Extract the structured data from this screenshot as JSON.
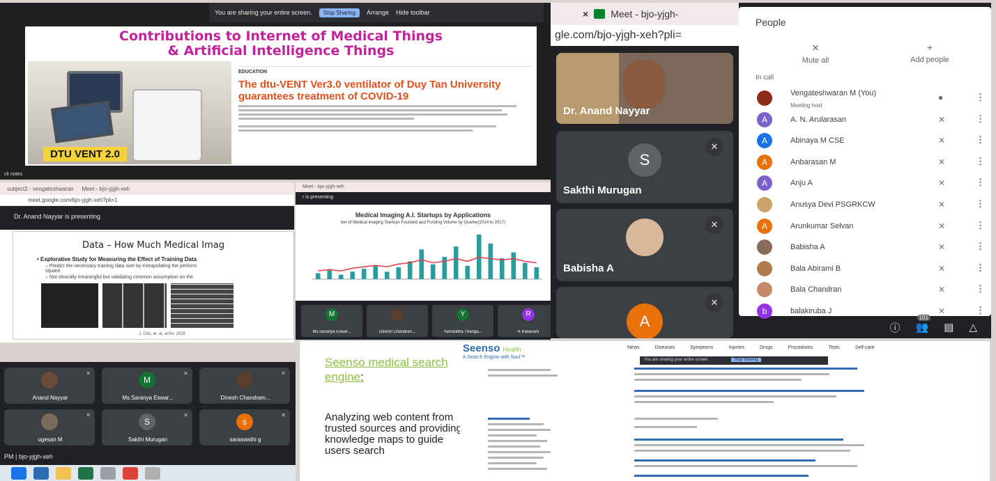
{
  "p1": {
    "sharebar": {
      "text": "You are sharing your entire screen.",
      "stop": "Stop Sharing",
      "arrange": "Arrange",
      "hide": "Hide toolbar"
    },
    "title_l1": "Contributions to Internet of Medical Things",
    "title_l2": "& Artificial Intelligence Things",
    "vent_label": "DTU VENT 2.0",
    "article_category": "EDUCATION",
    "headline": "The dtu-VENT Ver3.0 ventilator of Duy Tan University guarantees treatment of COVID-19",
    "footer": "ck notes"
  },
  "p2": {
    "tab_close": "×",
    "tab_title": "Meet - bjo-yjgh-",
    "url": "gle.com/bjo-yjgh-xeh?pli=",
    "tiles": [
      {
        "name": "Dr. Anand Nayyar"
      },
      {
        "name": "Sakthi Murugan",
        "initial": "S"
      },
      {
        "name": "Babisha A"
      },
      {
        "initial": "A"
      }
    ]
  },
  "p3": {
    "title": "People",
    "mute_all": "Mute all",
    "add_people": "Add people",
    "in_call": "In call",
    "badge": "101",
    "people": [
      {
        "name": "Vengateshwaran M (You)",
        "sub": "Meeting host",
        "color": "#8d2a1a",
        "initial": ""
      },
      {
        "name": "A. N. Arularasan",
        "color": "#7b61c9",
        "initial": "A"
      },
      {
        "name": "Abinaya M CSE",
        "color": "#1a73e8",
        "initial": "A"
      },
      {
        "name": "Anbarasan M",
        "color": "#e8710a",
        "initial": "A"
      },
      {
        "name": "Anju A",
        "color": "#7b61c9",
        "initial": "A"
      },
      {
        "name": "Anusya Devi PSGRKCW",
        "color": "#c9a36a",
        "initial": ""
      },
      {
        "name": "Arunkumar Selvan",
        "color": "#e8710a",
        "initial": "A"
      },
      {
        "name": "Babisha A",
        "color": "#8a6b5a",
        "initial": ""
      },
      {
        "name": "Bala Abirami B",
        "color": "#b07a4d",
        "initial": ""
      },
      {
        "name": "Bala Chandran",
        "color": "#c58a6a",
        "initial": ""
      },
      {
        "name": "balakiruba J",
        "color": "#9334e6",
        "initial": "b"
      }
    ]
  },
  "p4": {
    "tab1": "subject2 - vengateshwaran",
    "tab2": "Meet - bjo-yjgh-xeh",
    "url": "meet.google.com/bjo-yjgh-xeh?pli=1",
    "presenting": "Dr. Anand Nayyar is presenting",
    "slide_title": "Data – How Much Medical Imag",
    "bullet": "• Explorative Study for Measuring the Effect of Training Data",
    "sub1": "– Predict the necessary training data size by extrapolating the perform",
    "sub1b": "square.",
    "sub2": "– Not clinically meaningful but validating common assumption on the",
    "cite": "J. Cho, et. al, arXiv, 2015"
  },
  "p5": {
    "tab": "Meet - bjo-yjgh-xeh",
    "presenting": "r is presenting",
    "chart_title": "Medical Imaging A.I. Startups by Applications",
    "chart_sub": "ber of Medical Imaging Startups Founded and Funding Volume by Quarter(2014 to 2017)"
  },
  "chart_data": {
    "type": "bar",
    "title": "Medical Imaging A.I. Startups by Applications",
    "subtitle": "ber of Medical Imaging Startups Founded and Funding Volume by Quarter(2014 to 2017)",
    "values": [
      4,
      6,
      3,
      5,
      7,
      9,
      5,
      8,
      12,
      20,
      10,
      15,
      22,
      9,
      30,
      24,
      14,
      18,
      11,
      8
    ],
    "line": [
      6,
      7,
      6,
      8,
      9,
      10,
      9,
      11,
      12,
      14,
      12,
      13,
      15,
      13,
      16,
      15,
      14,
      15,
      13,
      12
    ],
    "colors": {
      "bar": "#2a9d9f",
      "line": "#e63946"
    }
  },
  "p6": {
    "thumbs": [
      {
        "name": "Ms.Saranya Eswar...",
        "initial": "M",
        "color": "#137333"
      },
      {
        "name": "Dinesh Chandran...",
        "initial": "",
        "color": "#5b3f2e"
      },
      {
        "name": "Yamanitha Thanga...",
        "initial": "Y",
        "color": "#137333"
      },
      {
        "name": "K Kalaivani",
        "initial": "R",
        "color": "#9334e6"
      }
    ]
  },
  "p7": {
    "tiles": [
      {
        "name": "Anand Nayyar",
        "initial": "",
        "color": "#6b4a3a"
      },
      {
        "name": "Ms.Saranya Eswar...",
        "initial": "M",
        "color": "#137333"
      },
      {
        "name": "Dinesh Chandram...",
        "initial": "",
        "color": "#5b3f2e"
      },
      {
        "name": "ugesan M",
        "initial": "",
        "color": "#7a6a5a"
      },
      {
        "name": "Sakthi Murugan",
        "initial": "S",
        "color": "#5f6368"
      },
      {
        "name": "saraswathi g",
        "initial": "s",
        "color": "#e8710a"
      }
    ],
    "bar": "PM  |  bjo-yjgh-xeh"
  },
  "p8": {
    "green": "Seenso medical search engine",
    "green_suffix": ":",
    "desc": "Analyzing web content from trusted sources and providing knowledge maps to guide users search",
    "logo": "Seenso",
    "logo_sub": "Health",
    "tagline": "A Search Engine with Soul™",
    "menu": [
      "News",
      "Diseases",
      "Symptoms",
      "Injuries",
      "Drugs",
      "Procedures",
      "Tests",
      "Self-care"
    ],
    "share": "You are sharing your entire screen.",
    "stop": "Stop Sharing"
  }
}
